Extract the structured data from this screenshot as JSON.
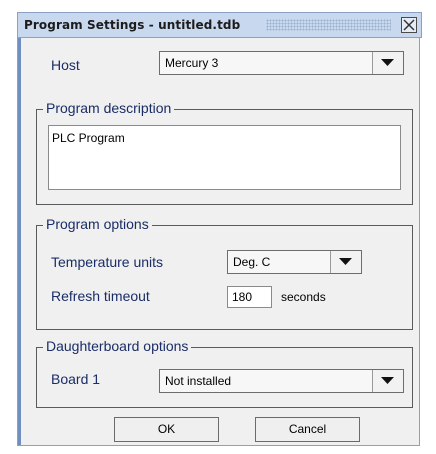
{
  "window": {
    "title": "Program Settings - untitled.tdb",
    "close_icon": "close-icon"
  },
  "host": {
    "label": "Host",
    "value": "Mercury 3"
  },
  "description": {
    "legend": "Program description",
    "value": "PLC Program"
  },
  "program_options": {
    "legend": "Program options",
    "temperature_label": "Temperature units",
    "temperature_value": "Deg. C",
    "refresh_label": "Refresh timeout",
    "refresh_value": "180",
    "refresh_unit": "seconds"
  },
  "daughterboard": {
    "legend": "Daughterboard options",
    "board_label": "Board 1",
    "board_value": "Not installed"
  },
  "buttons": {
    "ok": "OK",
    "cancel": "Cancel"
  },
  "colors": {
    "title_bar": "#c8d8ee",
    "label_text": "#1a2d66",
    "dialog_bg": "#f0f0f0"
  }
}
